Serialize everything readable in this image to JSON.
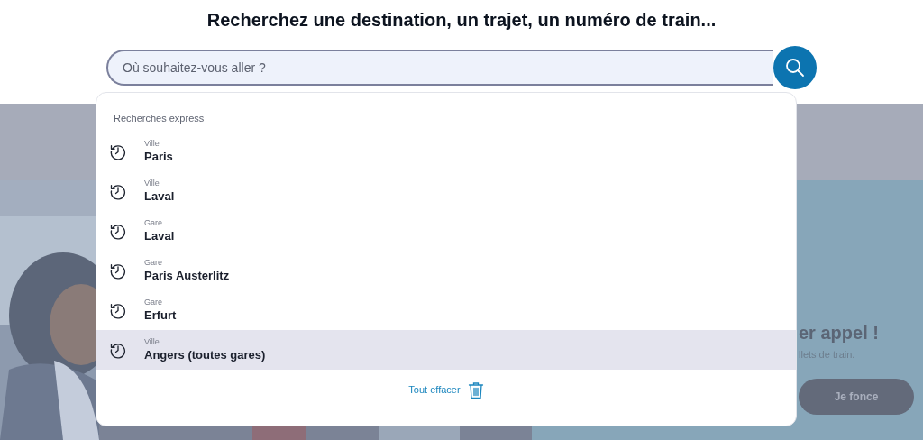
{
  "heading": "Recherchez une destination, un trajet, un numéro de train...",
  "search": {
    "placeholder": "Où souhaitez-vous aller ?"
  },
  "dropdown": {
    "section_title": "Recherches express",
    "items": [
      {
        "category": "Ville",
        "name": "Paris",
        "selected": false
      },
      {
        "category": "Ville",
        "name": "Laval",
        "selected": false
      },
      {
        "category": "Gare",
        "name": "Laval",
        "selected": false
      },
      {
        "category": "Gare",
        "name": "Paris Austerlitz",
        "selected": false
      },
      {
        "category": "Gare",
        "name": "Erfurt",
        "selected": false
      },
      {
        "category": "Ville",
        "name": "Angers (toutes gares)",
        "selected": true
      }
    ],
    "clear_label": "Tout effacer"
  },
  "background_promo": {
    "title": "er appel !",
    "subtitle": "llets de train.",
    "button": "Je fonce"
  }
}
